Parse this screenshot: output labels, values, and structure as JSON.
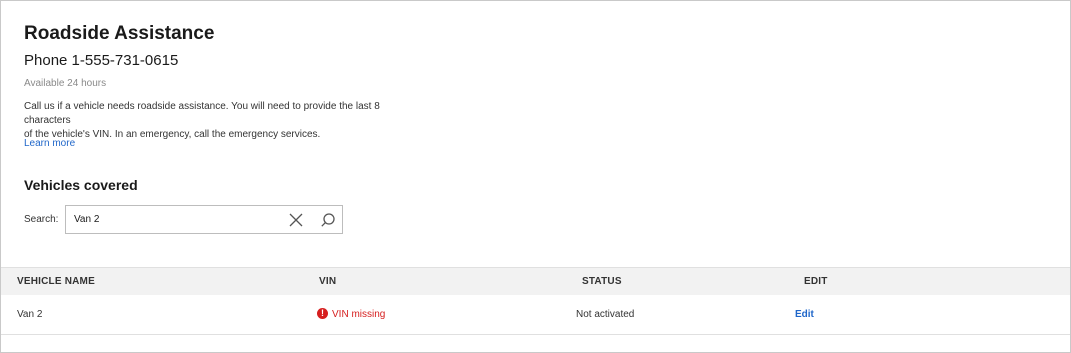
{
  "header": {
    "title": "Roadside Assistance",
    "phone": "Phone 1-555-731-0615",
    "availability": "Available 24 hours",
    "description_line1": "Call us if a vehicle needs roadside assistance. You will need to provide the last 8 characters",
    "description_line2": "of the vehicle's VIN. In an emergency, call the emergency services.",
    "learn_more": "Learn more"
  },
  "vehicles": {
    "section_title": "Vehicles covered",
    "search_label": "Search:",
    "search_value": "Van 2"
  },
  "table": {
    "columns": [
      "VEHICLE NAME",
      "VIN",
      "STATUS",
      "EDIT"
    ],
    "rows": [
      {
        "vehicle_name": "Van 2",
        "vin": "VIN missing",
        "status": "Not activated",
        "edit": "Edit"
      }
    ]
  },
  "colors": {
    "link": "#1f66c9",
    "error": "#d61f1f",
    "header_bg": "#f2f2f2"
  },
  "icons": [
    "clear-icon",
    "search-icon",
    "warning-icon"
  ]
}
